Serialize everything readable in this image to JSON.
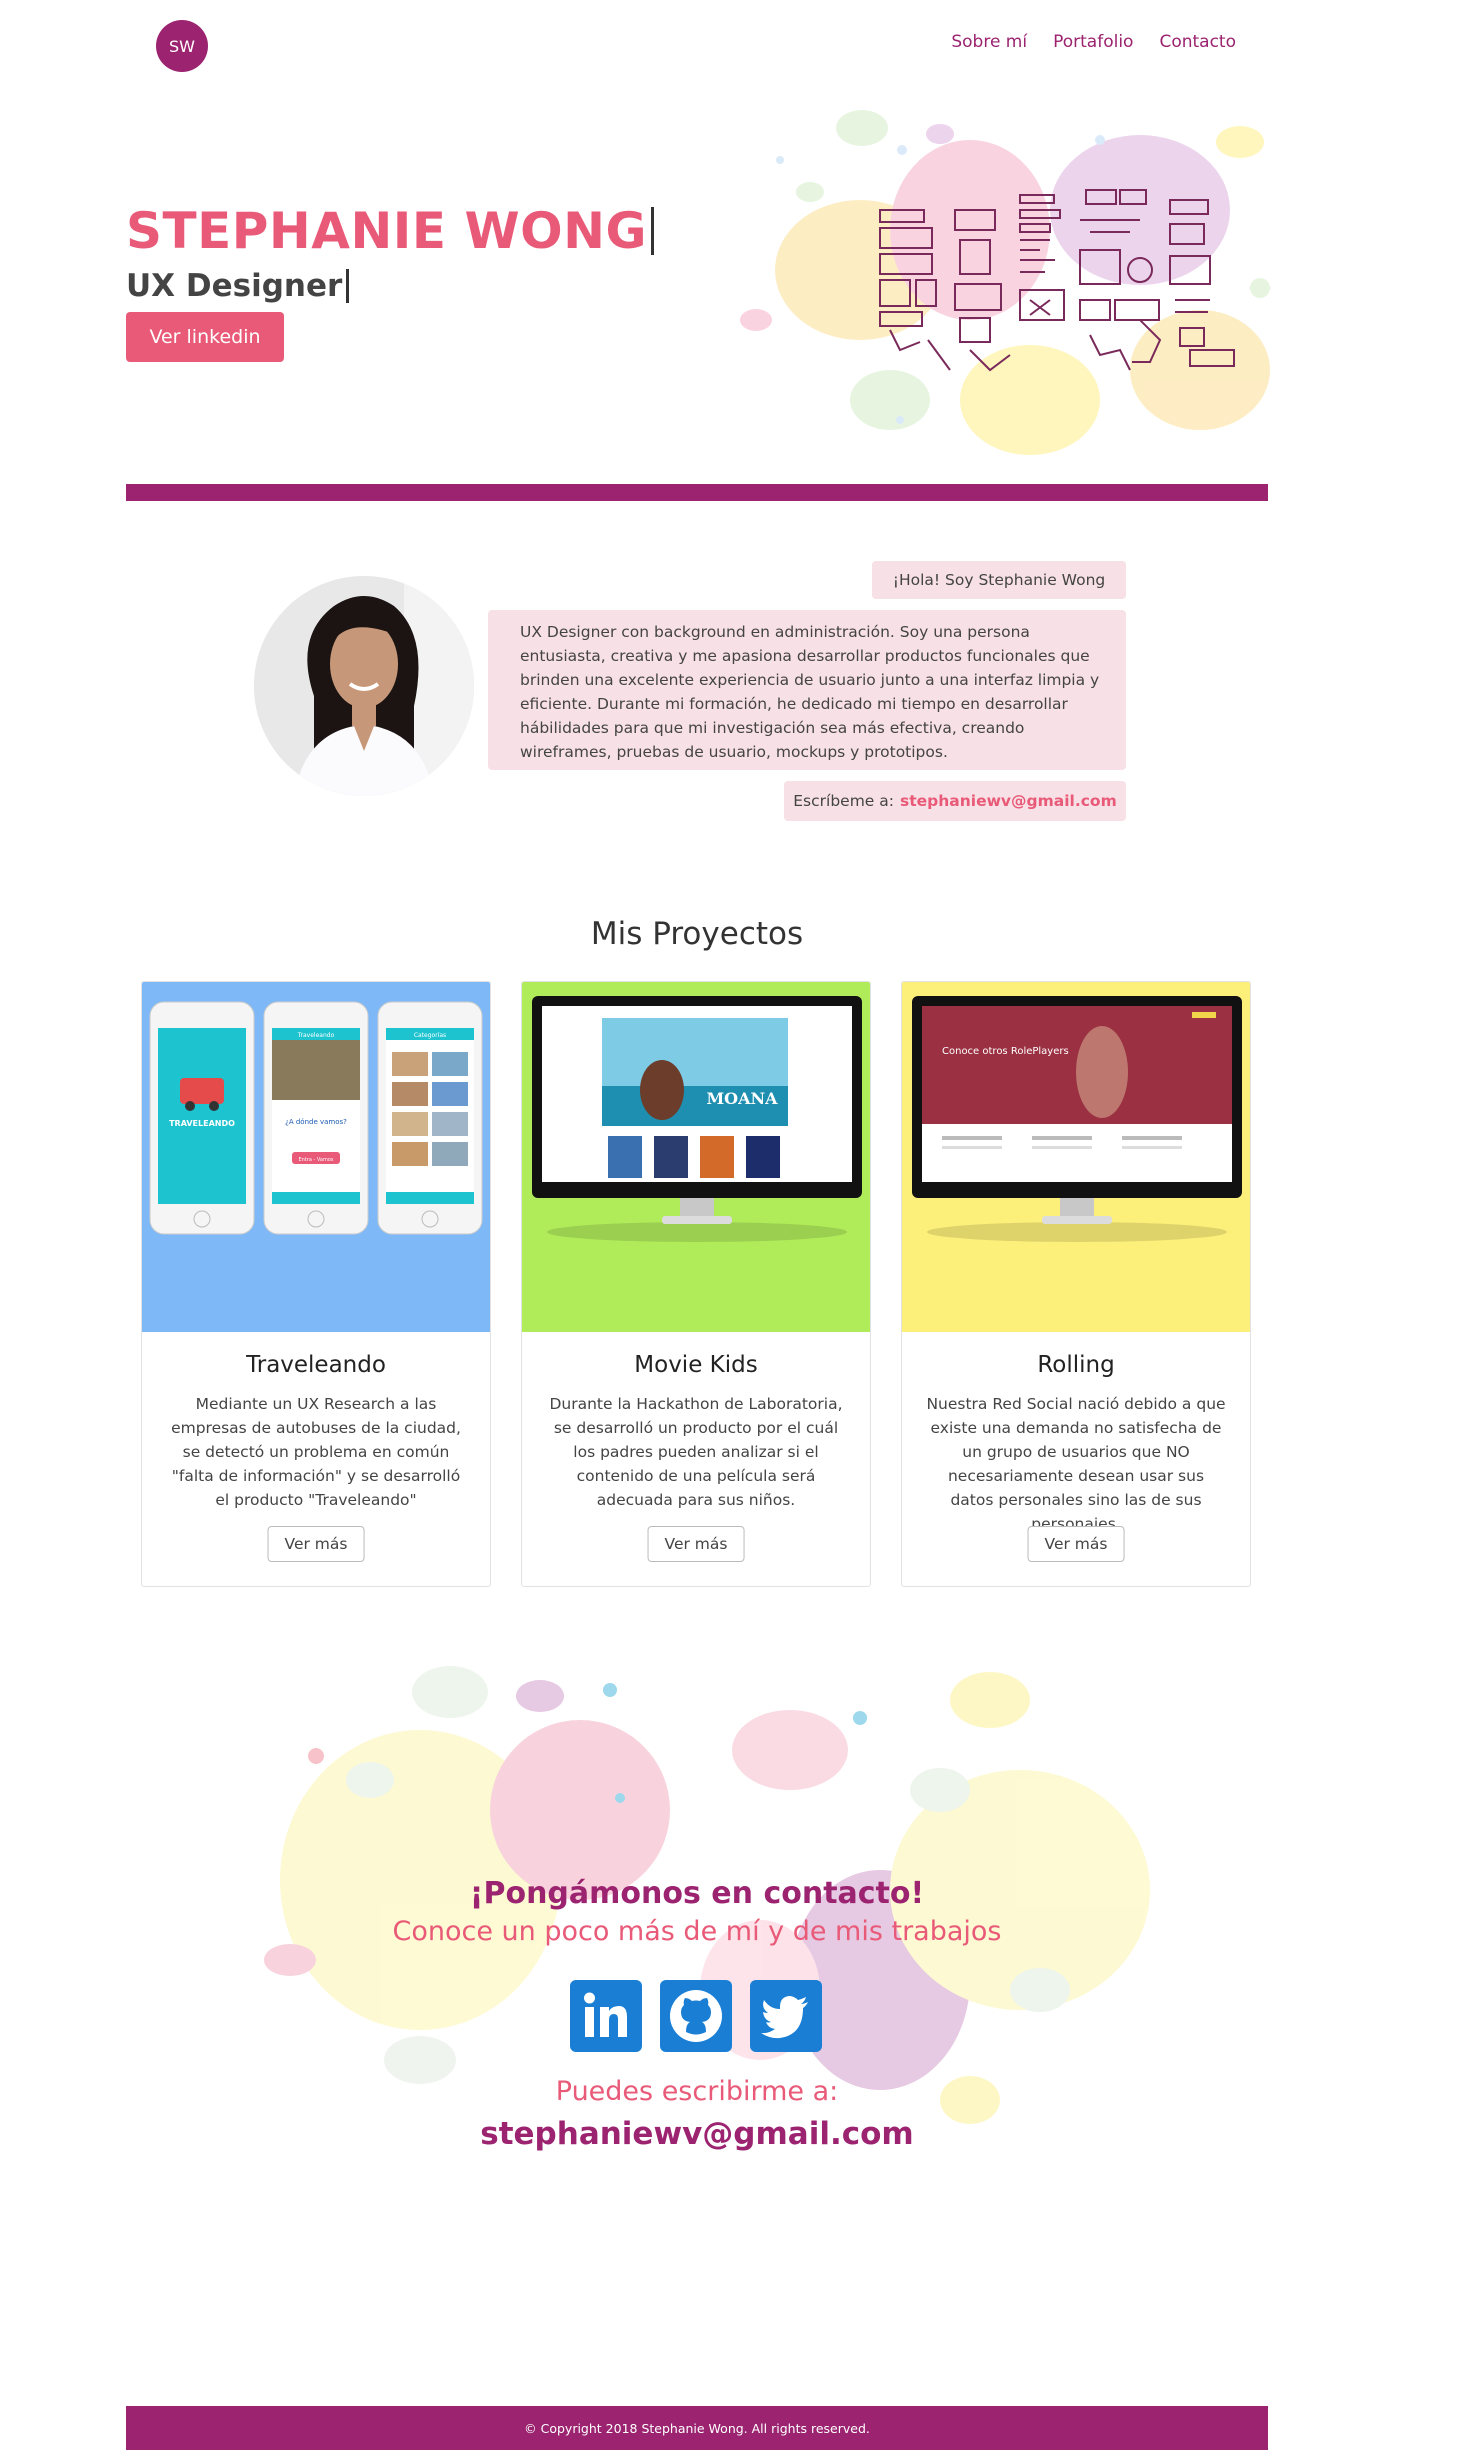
{
  "nav": {
    "logo": "SW",
    "links": [
      "Sobre mí",
      "Portafolio",
      "Contacto"
    ]
  },
  "hero": {
    "name": "STEPHANIE WONG",
    "role": "UX Designer",
    "button": "Ver linkedin"
  },
  "about": {
    "greeting": "¡Hola! Soy Stephanie Wong",
    "bio": "UX Designer con background en administración. Soy una persona entusiasta, creativa y me apasiona desarrollar productos funcionales que brinden una excelente experiencia de usuario junto a una interfaz limpia y eficiente. Durante mi formación, he dedicado mi tiempo en desarrollar hábilidades para que mi investigación sea más efectiva, creando wireframes, pruebas de usuario, mockups y prototipos.",
    "mail_label": "Escríbeme a:",
    "mail": "stephaniewv@gmail.com"
  },
  "projects": {
    "title": "Mis Proyectos",
    "items": [
      {
        "title": "Traveleando",
        "desc": "Mediante un UX Research a las empresas de autobuses de la ciudad, se detectó un problema en común \"falta de información\" y se desarrolló el producto \"Traveleando\"",
        "button": "Ver más",
        "bg": "#7fb8f7",
        "screen1": "TRAVELEANDO",
        "screen2_title": "Traveleando",
        "screen2_q": "¿A dónde vamos?",
        "screen2_btn": "Entra - Vamos",
        "screen3_title": "Categorías"
      },
      {
        "title": "Movie Kids",
        "desc": "Durante la Hackathon de Laboratoria, se desarrolló un producto por el cuál los padres pueden analizar si el contenido de una película será adecuada para sus niños.",
        "button": "Ver más",
        "bg": "#b0ec5a",
        "screen_label": "MOANA"
      },
      {
        "title": "Rolling",
        "desc": "Nuestra Red Social nació debido a que existe una demanda no satisfecha de un grupo de usuarios que NO necesariamente desean usar sus datos personales sino las de sus personajes.",
        "button": "Ver más",
        "bg": "#fdf07a",
        "screen_label": "Conoce otros RolePlayers"
      }
    ]
  },
  "contact": {
    "title": "¡Pongámonos en contacto!",
    "subtitle": "Conoce un poco más de mí y de mis trabajos",
    "write_label": "Puedes escribirme a:",
    "email": "stephaniewv@gmail.com",
    "socials": [
      "linkedin-icon",
      "github-icon",
      "twitter-icon"
    ]
  },
  "footer": {
    "text": "© Copyright 2018 Stephanie Wong. All rights reserved."
  },
  "colors": {
    "brand": "#9b2370",
    "accent": "#e85a78",
    "bubble": "#f8e1e6",
    "social": "#1a7fd4"
  }
}
